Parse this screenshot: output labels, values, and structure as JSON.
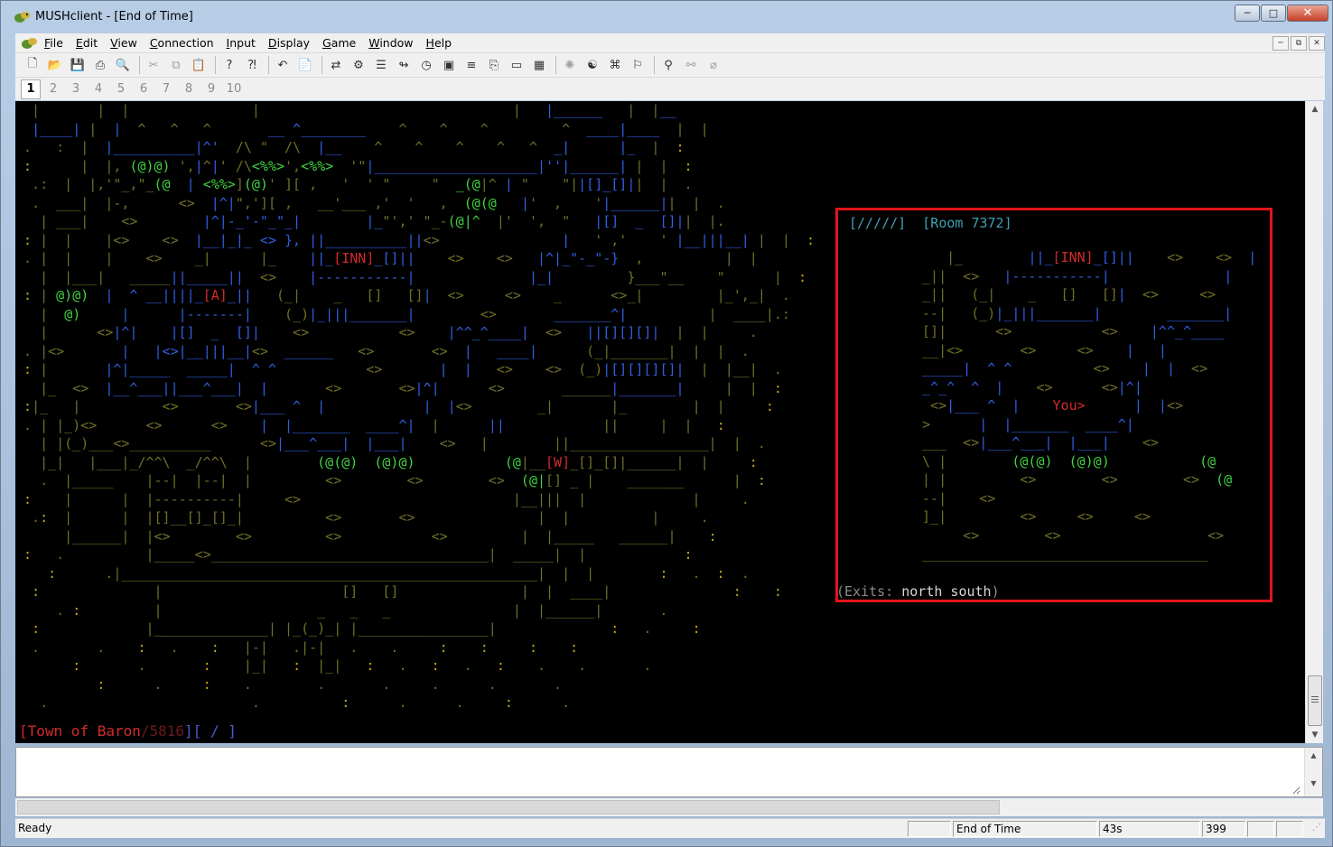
{
  "window": {
    "title": "MUSHclient - [End of Time]"
  },
  "menu": [
    {
      "label": "File",
      "accel": "F"
    },
    {
      "label": "Edit",
      "accel": "E"
    },
    {
      "label": "View",
      "accel": "V"
    },
    {
      "label": "Connection",
      "accel": "C"
    },
    {
      "label": "Input",
      "accel": "I"
    },
    {
      "label": "Display",
      "accel": "D"
    },
    {
      "label": "Game",
      "accel": "G"
    },
    {
      "label": "Window",
      "accel": "W"
    },
    {
      "label": "Help",
      "accel": "H"
    }
  ],
  "toolbar": [
    "new-world-icon",
    "open-icon",
    "save-icon",
    "print-icon",
    "print-preview-icon",
    "cut-icon",
    "copy-icon",
    "paste-icon",
    "help-icon",
    "context-help-icon",
    "undo-icon",
    "notepad-icon",
    "connect-icon",
    "world-config-icon",
    "triggers-icon",
    "aliases-icon",
    "timers-icon",
    "output-font-icon",
    "input-history-icon",
    "log-session-icon",
    "command-window-icon",
    "text-window-icon",
    "mapper-icon",
    "auto-say-icon",
    "macros-icon",
    "keypad-icon",
    "find-icon",
    "find-again-icon",
    "reset-icon"
  ],
  "world_tabs": [
    "1",
    "2",
    "3",
    "4",
    "5",
    "6",
    "7",
    "8",
    "9",
    "10"
  ],
  "active_tab": "1",
  "prompt": {
    "area": "Town of Baron",
    "vnum": "5816",
    "rest": "][ / ]",
    "sep": "/",
    "open": "["
  },
  "minimap": {
    "header": "[/////]",
    "room": "[Room 7372]",
    "you": "You",
    "exits_label": "Exits:",
    "exits": "north south"
  },
  "status": {
    "ready": "Ready",
    "world": "End of Time",
    "time": "43s",
    "lines": "399"
  },
  "colors": {
    "prompt": "#d12a2a",
    "minimap_border": "#e2151b",
    "map_green": "#3fd43f",
    "map_blue": "#2f5fe0"
  }
}
